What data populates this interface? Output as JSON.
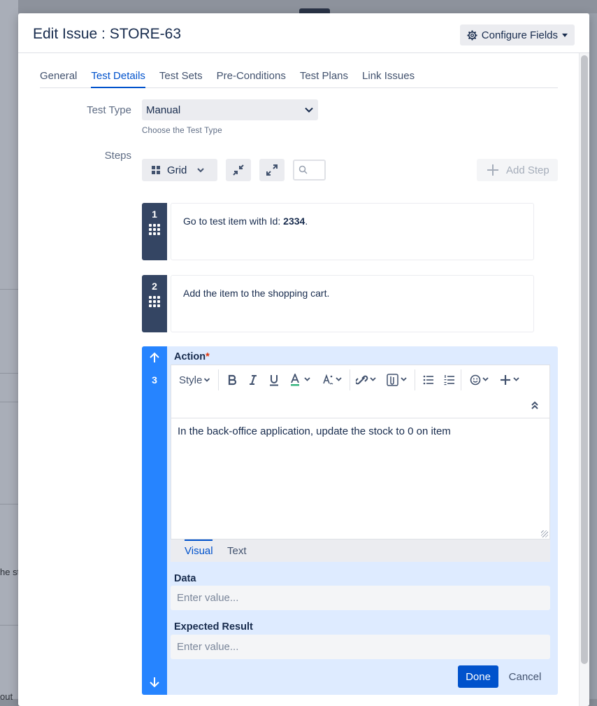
{
  "modal": {
    "title": "Edit Issue : STORE-63",
    "configure_label": "Configure Fields"
  },
  "tabs": [
    {
      "label": "General"
    },
    {
      "label": "Test Details"
    },
    {
      "label": "Test Sets"
    },
    {
      "label": "Pre-Conditions"
    },
    {
      "label": "Test Plans"
    },
    {
      "label": "Link Issues"
    }
  ],
  "test_type": {
    "label": "Test Type",
    "value": "Manual",
    "help": "Choose the Test Type"
  },
  "steps": {
    "label": "Steps",
    "view_label": "Grid",
    "add_step_label": "Add Step",
    "items": [
      {
        "number": "1",
        "text_prefix": "Go to test item with Id: ",
        "text_bold": "2334",
        "text_suffix": "."
      },
      {
        "number": "2",
        "text": "Add the item to the shopping cart."
      }
    ],
    "active": {
      "number": "3",
      "action_label": "Action",
      "required_mark": "*",
      "style_label": "Style",
      "action_text": "In the back-office application, update the stock to 0 on item",
      "visual_tab": "Visual",
      "text_tab": "Text",
      "data_label": "Data",
      "data_placeholder": "Enter value...",
      "expected_label": "Expected Result",
      "expected_placeholder": "Enter value...",
      "done_label": "Done",
      "cancel_label": "Cancel"
    }
  },
  "background": {
    "partial_text_1": "he st",
    "partial_text_2": "out"
  },
  "colors": {
    "primary": "#0052cc",
    "step_dark": "#344563",
    "step_active": "#2684ff",
    "active_bg": "#deebff"
  }
}
